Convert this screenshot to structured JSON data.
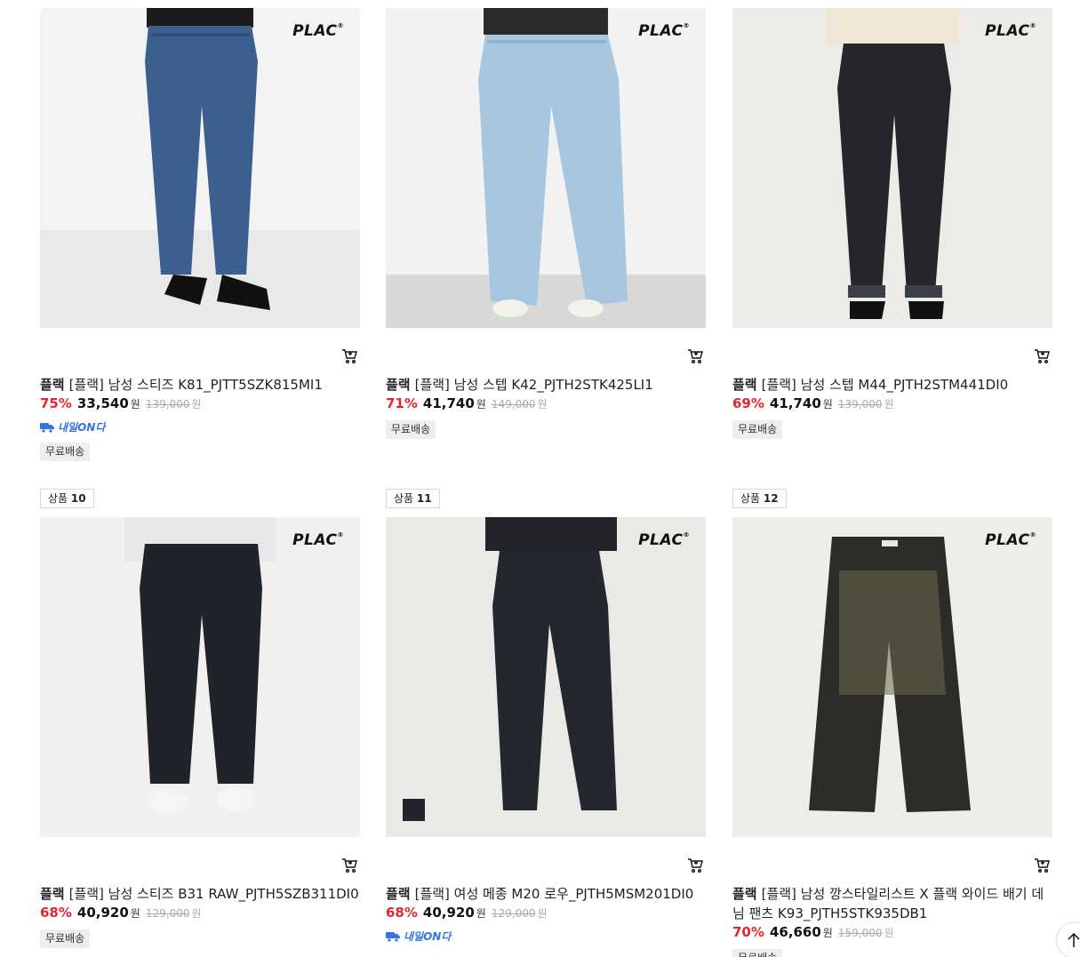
{
  "brand_logo": "PLAC",
  "cards": [
    {
      "brand": "플랙",
      "title": "[플랙] 남성 스티즈 K81_PJTT5SZK815MI1",
      "rate": "75%",
      "price": "33,540",
      "won": "원",
      "orig": "139,000",
      "orig_won": "원",
      "delivery": "내일ON다",
      "free_ship": "무료배송"
    },
    {
      "brand": "플랙",
      "title": "[플랙] 남성 스텝 K42_PJTH2STK425LI1",
      "rate": "71%",
      "price": "41,740",
      "won": "원",
      "orig": "149,000",
      "orig_won": "원",
      "free_ship": "무료배송"
    },
    {
      "brand": "플랙",
      "title": "[플랙] 남성 스텝 M44_PJTH2STM441DI0",
      "rate": "69%",
      "price": "41,740",
      "won": "원",
      "orig": "139,000",
      "orig_won": "원",
      "free_ship": "무료배송"
    },
    {
      "rank_label": "상품",
      "rank_num": "10",
      "brand": "플랙",
      "title": "[플랙] 남성 스티즈 B31 RAW_PJTH5SZB311DI0",
      "rate": "68%",
      "price": "40,920",
      "won": "원",
      "orig": "129,000",
      "orig_won": "원",
      "free_ship": "무료배송"
    },
    {
      "rank_label": "상품",
      "rank_num": "11",
      "brand": "플랙",
      "title": "[플랙] 여성 메종 M20 로우_PJTH5MSM201DI0",
      "rate": "68%",
      "price": "40,920",
      "won": "원",
      "orig": "129,000",
      "orig_won": "원",
      "delivery": "내일ON다"
    },
    {
      "rank_label": "상품",
      "rank_num": "12",
      "brand": "플랙",
      "title": "[플랙] 남성 깡스타일리스트 X 플랙 와이드 배기 데님 팬츠 K93_PJTH5STK935DB1",
      "rate": "70%",
      "price": "46,660",
      "won": "원",
      "orig": "159,000",
      "orig_won": "원",
      "free_ship": "무료배송"
    }
  ],
  "colors": {
    "discount": "#e6262e",
    "delivery": "#3273e8"
  }
}
